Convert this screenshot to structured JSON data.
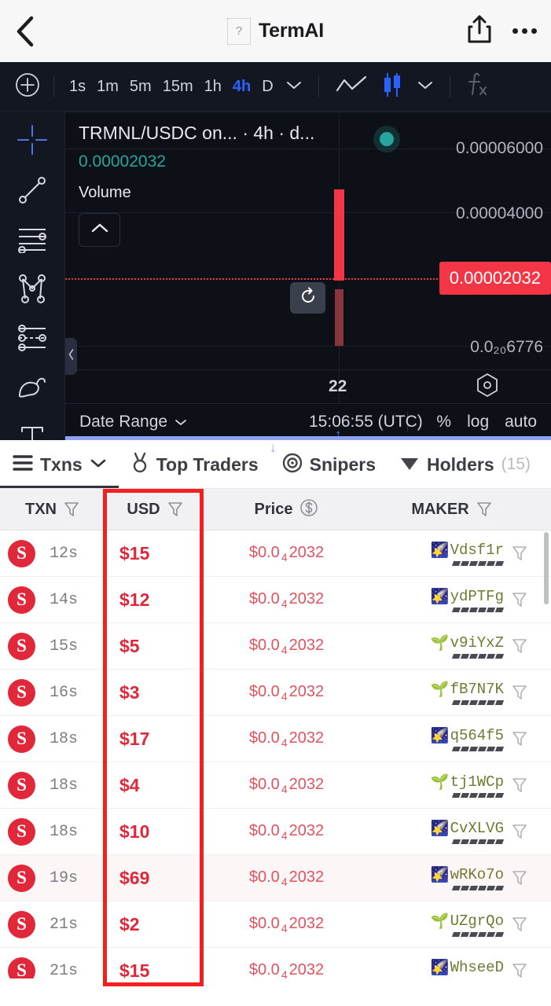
{
  "navbar": {
    "back_icon": "chevron-left-icon",
    "favicon_glyph": "?",
    "title": "TermAI",
    "share_icon": "share-icon",
    "more_icon": "more-dots-icon"
  },
  "chart_toolbar": {
    "add_icon": "plus-circle-icon",
    "timeframes": [
      {
        "label": "1s",
        "active": false
      },
      {
        "label": "1m",
        "active": false
      },
      {
        "label": "5m",
        "active": false
      },
      {
        "label": "15m",
        "active": false
      },
      {
        "label": "1h",
        "active": false
      },
      {
        "label": "4h",
        "active": true
      },
      {
        "label": "D",
        "active": false
      }
    ],
    "timeframe_more_icon": "chevron-down-icon",
    "line_chart_icon": "line-chart-icon",
    "candle_chart_icon": "candlestick-icon",
    "chart_type_more_icon": "chevron-down-icon",
    "indicator_icon": "fx-icon"
  },
  "draw_tools": [
    {
      "name": "crosshair-tool",
      "active": true
    },
    {
      "name": "trend-line-tool",
      "active": false
    },
    {
      "name": "horizontal-lines-tool",
      "active": false
    },
    {
      "name": "pitchfork-tool",
      "active": false
    },
    {
      "name": "fib-tool",
      "active": false
    },
    {
      "name": "brush-tool",
      "active": false
    },
    {
      "name": "text-tool",
      "active": false
    }
  ],
  "chart": {
    "legend_title": "TRMNL/USDC on... · 4h · d...",
    "legend_price": "0.00002032",
    "legend_volume_label": "Volume",
    "collapse_icon": "chevron-up-icon",
    "live_status": "live-indicator",
    "replay_icon": "replay-icon",
    "side_collapse_icon": "chevron-left-icon",
    "axis_labels": [
      "0.00006000",
      "0.00004000",
      "0.0₂₀6776"
    ],
    "current_price_tag": "0.00002032",
    "time_tick": "22",
    "settings_icon": "gear-hex-icon"
  },
  "chart_footer": {
    "date_range_label": "Date Range",
    "date_range_icon": "chevron-down-icon",
    "clock": "15:06:55 (UTC)",
    "percent_label": "%",
    "log_label": "log",
    "auto_label": "auto"
  },
  "tabs": [
    {
      "label": "Txns",
      "icon": "list-icon",
      "count": "",
      "active": true,
      "has_chevron": true
    },
    {
      "label": "Top Traders",
      "icon": "medal-icon",
      "count": "",
      "active": false,
      "has_chevron": false
    },
    {
      "label": "Snipers",
      "icon": "target-icon",
      "count": "",
      "active": false,
      "has_chevron": false
    },
    {
      "label": "Holders",
      "icon": "diamond-icon",
      "count": "(15)",
      "active": false,
      "has_chevron": false
    }
  ],
  "table": {
    "columns": [
      {
        "label": "TXN",
        "icon": "funnel-icon"
      },
      {
        "label": "USD",
        "icon": "funnel-icon"
      },
      {
        "label": "Price",
        "icon": "dollar-circle-icon"
      },
      {
        "label": "MAKER",
        "icon": "funnel-icon"
      }
    ],
    "rows": [
      {
        "type": "S",
        "age": "12s",
        "usd": "$15",
        "price_prefix": "$0.0",
        "price_sub": "4",
        "price_suffix": "2032",
        "maker": "Vdsf1r",
        "maker_emoji": "🌠",
        "alt": false
      },
      {
        "type": "S",
        "age": "14s",
        "usd": "$12",
        "price_prefix": "$0.0",
        "price_sub": "4",
        "price_suffix": "2032",
        "maker": "ydPTFg",
        "maker_emoji": "🌠",
        "alt": false
      },
      {
        "type": "S",
        "age": "15s",
        "usd": "$5",
        "price_prefix": "$0.0",
        "price_sub": "4",
        "price_suffix": "2032",
        "maker": "v9iYxZ",
        "maker_emoji": "🌱",
        "alt": false
      },
      {
        "type": "S",
        "age": "16s",
        "usd": "$3",
        "price_prefix": "$0.0",
        "price_sub": "4",
        "price_suffix": "2032",
        "maker": "fB7N7K",
        "maker_emoji": "🌱",
        "alt": false
      },
      {
        "type": "S",
        "age": "18s",
        "usd": "$17",
        "price_prefix": "$0.0",
        "price_sub": "4",
        "price_suffix": "2032",
        "maker": "q564f5",
        "maker_emoji": "🌠",
        "alt": false
      },
      {
        "type": "S",
        "age": "18s",
        "usd": "$4",
        "price_prefix": "$0.0",
        "price_sub": "4",
        "price_suffix": "2032",
        "maker": "tj1WCp",
        "maker_emoji": "🌱",
        "alt": false
      },
      {
        "type": "S",
        "age": "18s",
        "usd": "$10",
        "price_prefix": "$0.0",
        "price_sub": "4",
        "price_suffix": "2032",
        "maker": "CvXLVG",
        "maker_emoji": "🌠",
        "alt": false
      },
      {
        "type": "S",
        "age": "19s",
        "usd": "$69",
        "price_prefix": "$0.0",
        "price_sub": "4",
        "price_suffix": "2032",
        "maker": "wRKo7o",
        "maker_emoji": "🌠",
        "alt": true
      },
      {
        "type": "S",
        "age": "21s",
        "usd": "$2",
        "price_prefix": "$0.0",
        "price_sub": "4",
        "price_suffix": "2032",
        "maker": "UZgrQo",
        "maker_emoji": "🌱",
        "alt": false
      },
      {
        "type": "S",
        "age": "21s",
        "usd": "$15",
        "price_prefix": "$0.0",
        "price_sub": "4",
        "price_suffix": "2032",
        "maker": "WhseeD",
        "maker_emoji": "🌠",
        "alt": false
      }
    ]
  },
  "colors": {
    "accent_red": "#e0283a",
    "price_red": "#e2525f",
    "chart_red": "#f23645",
    "chart_green": "#26a69a",
    "toolbar_blue": "#2962ff",
    "chart_bg": "#0e1018",
    "toolbar_bg": "#131722",
    "annotation_red": "#f42020"
  }
}
